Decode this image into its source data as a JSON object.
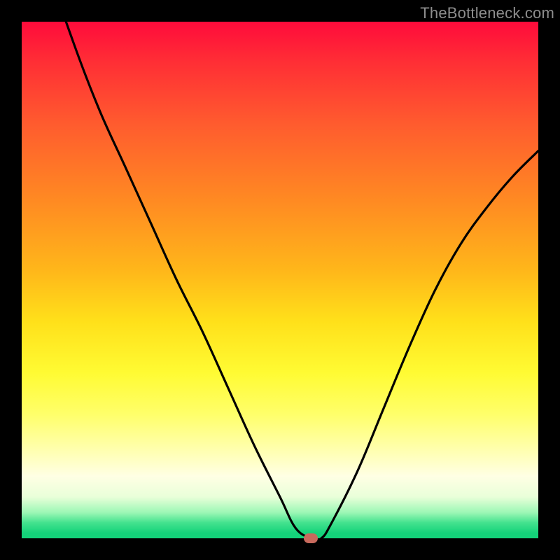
{
  "watermark": "TheBottleneck.com",
  "chart_data": {
    "type": "line",
    "title": "",
    "xlabel": "",
    "ylabel": "",
    "xlim": [
      0,
      100
    ],
    "ylim": [
      0,
      100
    ],
    "series": [
      {
        "name": "bottleneck-curve",
        "x": [
          0,
          5,
          10,
          15,
          20,
          25,
          30,
          35,
          40,
          45,
          50,
          53,
          56,
          58,
          60,
          65,
          70,
          75,
          80,
          85,
          90,
          95,
          100
        ],
        "values": [
          130,
          111,
          96,
          83,
          72,
          61,
          50,
          40,
          29,
          18,
          8,
          2,
          0,
          0,
          3,
          13,
          25,
          37,
          48,
          57,
          64,
          70,
          75
        ]
      }
    ],
    "annotations": [
      {
        "name": "optimal-point",
        "x": 56,
        "y": 0
      }
    ]
  },
  "colors": {
    "curve": "#000000",
    "marker": "#c96a5d"
  }
}
